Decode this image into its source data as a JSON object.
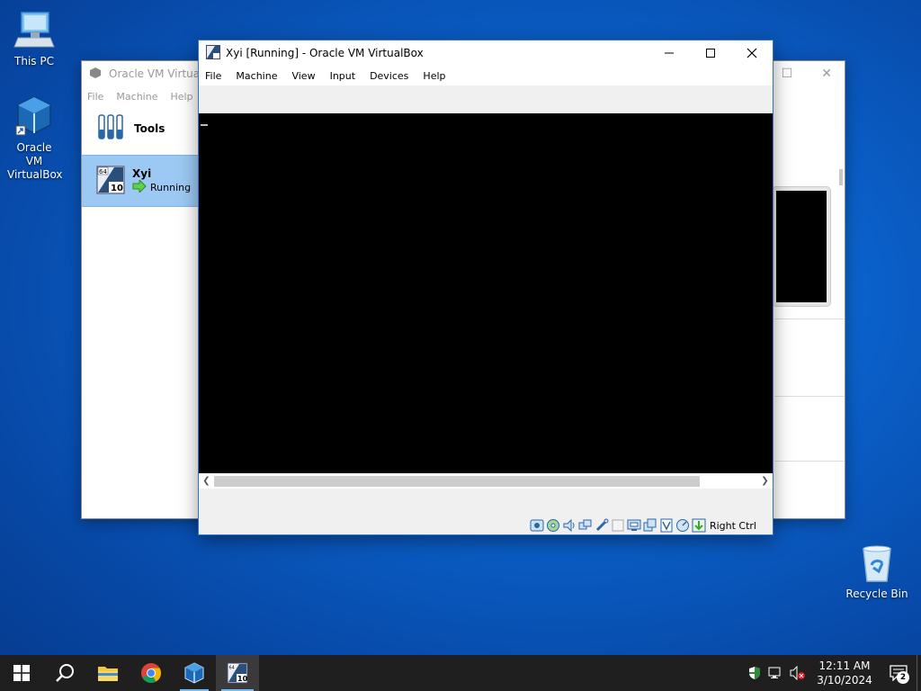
{
  "desktop": {
    "icons": [
      {
        "label": "This PC"
      },
      {
        "label": "Oracle VM VirtualBox"
      },
      {
        "label": "Recycle Bin"
      }
    ]
  },
  "manager": {
    "title": "Oracle VM VirtualBox Manager",
    "menu": [
      "File",
      "Machine",
      "Help"
    ],
    "tools_label": "Tools",
    "vm": {
      "name": "Xyi",
      "state": "Running"
    }
  },
  "vm_window": {
    "title": "Xyi [Running] - Oracle VM VirtualBox",
    "menu": [
      "File",
      "Machine",
      "View",
      "Input",
      "Devices",
      "Help"
    ],
    "host_key": "Right Ctrl"
  },
  "taskbar": {
    "time": "12:11 AM",
    "date": "3/10/2024",
    "notification_count": "2"
  },
  "colors": {
    "accent": "#2b74c7",
    "selection": "#9cc9f3",
    "taskbar": "#1f1f1f"
  }
}
